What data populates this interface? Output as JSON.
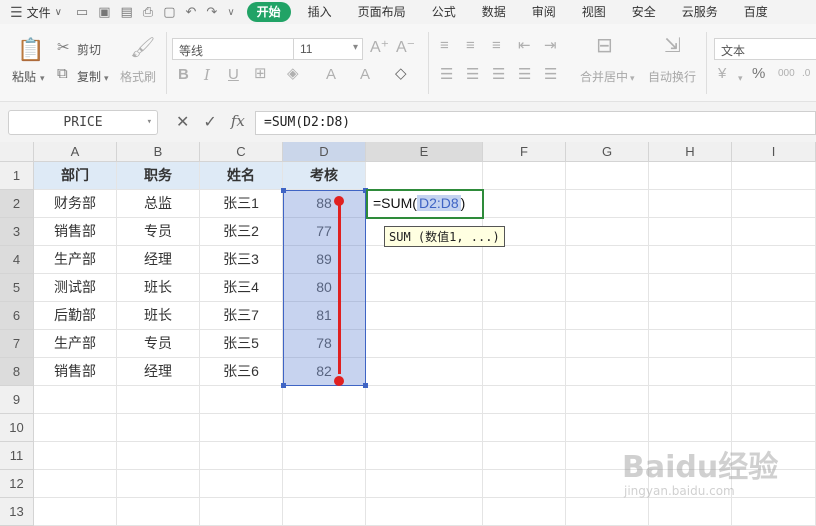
{
  "menu": {
    "file_label": "文件",
    "tabs": [
      "开始",
      "插入",
      "页面布局",
      "公式",
      "数据",
      "审阅",
      "视图",
      "安全",
      "云服务",
      "百度"
    ]
  },
  "ribbon": {
    "paste": "粘贴",
    "cut": "剪切",
    "copy": "复制",
    "format_painter": "格式刷",
    "font_name": "等线",
    "font_size": "11",
    "merge_center": "合并居中",
    "wrap_text": "自动换行",
    "number_format": "文本"
  },
  "formula_bar": {
    "name_box": "PRICE",
    "fx": "fx",
    "formula": "=SUM(D2:D8)"
  },
  "grid": {
    "columns": [
      "A",
      "B",
      "C",
      "D",
      "E",
      "F",
      "G",
      "H",
      "I"
    ],
    "rows": [
      "1",
      "2",
      "3",
      "4",
      "5",
      "6",
      "7",
      "8",
      "9",
      "10",
      "11",
      "12",
      "13"
    ],
    "headers": [
      "部门",
      "职务",
      "姓名",
      "考核"
    ],
    "data": [
      [
        "财务部",
        "总监",
        "张三1",
        "88"
      ],
      [
        "销售部",
        "专员",
        "张三2",
        "77"
      ],
      [
        "生产部",
        "经理",
        "张三3",
        "89"
      ],
      [
        "测试部",
        "班长",
        "张三4",
        "80"
      ],
      [
        "后勤部",
        "班长",
        "张三7",
        "81"
      ],
      [
        "生产部",
        "专员",
        "张三5",
        "78"
      ],
      [
        "销售部",
        "经理",
        "张三6",
        "82"
      ]
    ],
    "active_cell_prefix": "=SUM(",
    "active_cell_ref": "D2:D8",
    "active_cell_suffix": ")",
    "tooltip": "SUM (数值1, ...)"
  },
  "watermark": {
    "logo": "Baidu经验",
    "url": "jingyan.baidu.com"
  },
  "colors": {
    "accent_green": "#21a366",
    "selection_blue": "#3f64c4",
    "annotation_red": "#e02020",
    "header_fill": "#deeaf6"
  }
}
